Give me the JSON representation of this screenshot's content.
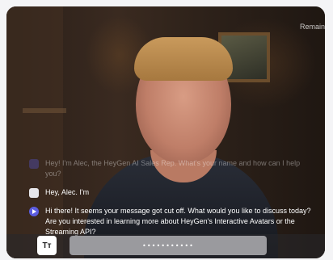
{
  "overlay": {
    "remaining_text": "Remain"
  },
  "chat": {
    "messages": [
      {
        "role": "bot",
        "text": "Hey! I'm Alec, the HeyGen AI Sales Rep. What's your name and how can I help you?"
      },
      {
        "role": "user",
        "text": "Hey, Alec. I'm"
      },
      {
        "role": "bot",
        "text": "Hi there! It seems your message got cut off. What would you like to discuss today? Are you interested in learning more about HeyGen's Interactive Avatars or the Streaming API?"
      }
    ]
  },
  "input": {
    "text_toggle_label": "Tт",
    "password_value": "•••••••••••"
  },
  "icons": {
    "user_avatar": "user-avatar-icon",
    "bot_avatar": "play-icon",
    "text_toggle": "text-size-icon"
  },
  "colors": {
    "bot_accent": "#5b5de0",
    "input_bg": "#9a9a9e"
  }
}
